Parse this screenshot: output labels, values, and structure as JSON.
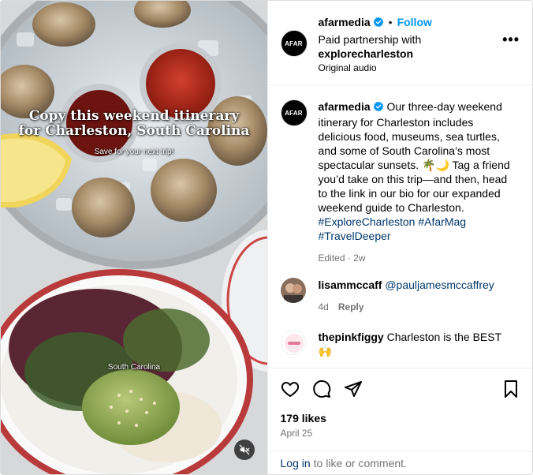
{
  "media": {
    "overlay_title_line1": "Copy this weekend itinerary",
    "overlay_title_line2": "for Charleston, South Carolina",
    "overlay_sub": "Save for your next trip!",
    "overlay_location": "South Carolina",
    "mute_icon": "speaker-muted-icon"
  },
  "header": {
    "avatar_text": "AFAR",
    "username": "afarmedia",
    "follow_label": "Follow",
    "partnership_prefix": "Paid partnership with",
    "partner": "explorecharleston",
    "audio": "Original audio",
    "more_icon": "more-options-icon"
  },
  "caption": {
    "avatar_text": "AFAR",
    "username": "afarmedia",
    "text_part1": "Our three-day weekend itinerary for Charleston includes delicious food, museums, sea turtles, and some of South Carolina’s most spectacular sunsets. 🌴🌙 Tag a friend you’d take on this trip—and then, head to the link in our bio for our expanded weekend guide to Charleston.",
    "hashtags": [
      "#ExploreCharleston",
      "#AfarMag",
      "#TravelDeeper"
    ],
    "edited": "Edited",
    "age": "2w"
  },
  "comments": [
    {
      "username": "lisammccaff",
      "text": "@pauljamesmccaffrey",
      "age": "4d",
      "reply_label": "Reply"
    },
    {
      "username": "thepinkfiggy",
      "text": "Charleston is the BEST 🙌"
    }
  ],
  "actions": {
    "like_icon": "heart-icon",
    "comment_icon": "comment-icon",
    "share_icon": "share-icon",
    "save_icon": "bookmark-icon",
    "likes": "179 likes",
    "date": "April 25"
  },
  "footer": {
    "login_label": "Log in",
    "login_rest": "to like or comment."
  },
  "colors": {
    "link_blue": "#0095f6",
    "hashtag_blue": "#00376b",
    "muted_gray": "#737373",
    "verified_blue": "#0095f6"
  }
}
